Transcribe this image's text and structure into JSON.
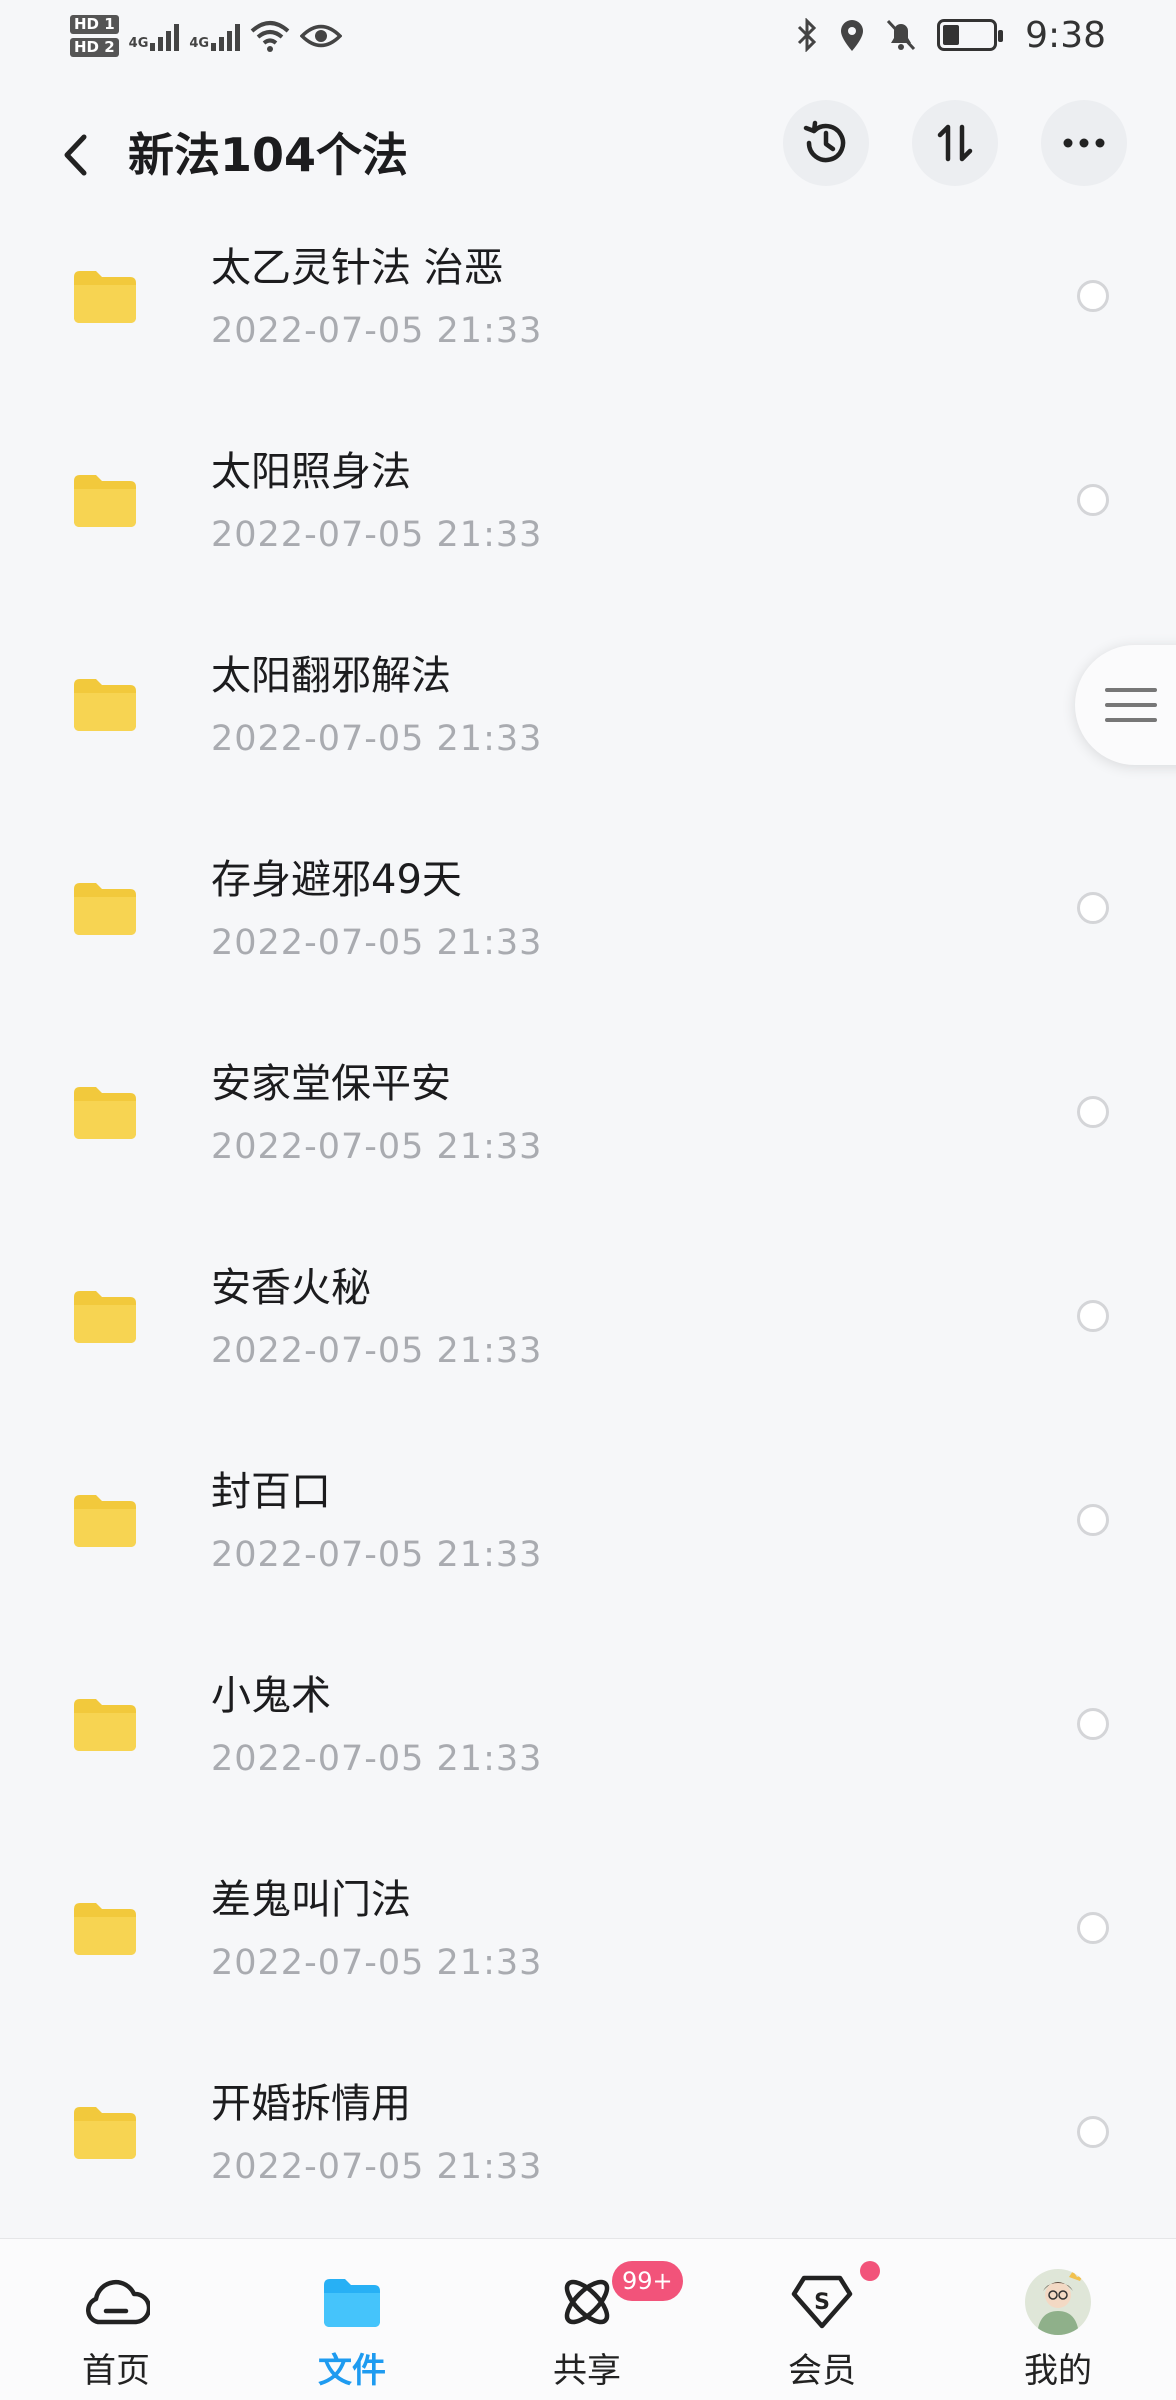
{
  "status_bar": {
    "hd1": "HD 1",
    "hd2": "HD 2",
    "net1": "4G",
    "net2": "4G",
    "time": "9:38"
  },
  "header": {
    "title": "新法104个法"
  },
  "files": [
    {
      "name": "太乙灵针法 治恶",
      "date": "2022-07-05  21:33"
    },
    {
      "name": "太阳照身法",
      "date": "2022-07-05  21:33"
    },
    {
      "name": "太阳翻邪解法",
      "date": "2022-07-05  21:33"
    },
    {
      "name": "存身避邪49天",
      "date": "2022-07-05  21:33"
    },
    {
      "name": "安家堂保平安",
      "date": "2022-07-05  21:33"
    },
    {
      "name": "安香火秘",
      "date": "2022-07-05  21:33"
    },
    {
      "name": "封百口",
      "date": "2022-07-05  21:33"
    },
    {
      "name": "小鬼术",
      "date": "2022-07-05  21:33"
    },
    {
      "name": "差鬼叫门法",
      "date": "2022-07-05  21:33"
    },
    {
      "name": "开婚拆情用",
      "date": "2022-07-05  21:33"
    }
  ],
  "bottom_nav": {
    "items": [
      {
        "label": "首页",
        "icon": "cloud-icon"
      },
      {
        "label": "文件",
        "icon": "folder-icon"
      },
      {
        "label": "共享",
        "icon": "share-orbit-icon"
      },
      {
        "label": "会员",
        "icon": "vip-diamond-icon"
      },
      {
        "label": "我的",
        "icon": "avatar"
      }
    ],
    "share_badge": "99+"
  },
  "colors": {
    "folder": "#f7d452",
    "accent": "#1e9bf0",
    "badge": "#f2537a",
    "date_text": "#a9abb0"
  }
}
